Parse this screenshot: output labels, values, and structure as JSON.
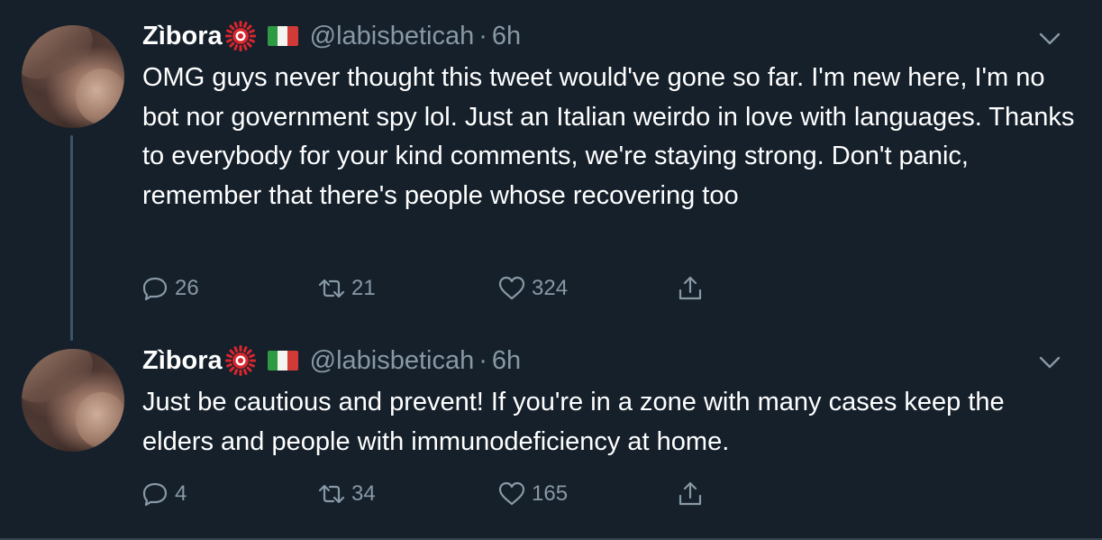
{
  "tweets": [
    {
      "display_name": "Zìbora",
      "handle": "@labisbeticah",
      "separator": "·",
      "time": "6h",
      "text": "OMG guys never thought this tweet would've gone so far. I'm new here, I'm no bot nor government spy lol. Just an Italian weirdo in love with languages. Thanks to everybody for your kind comments, we're staying strong. Don't panic, remember that there's people whose recovering too",
      "replies": "26",
      "retweets": "21",
      "likes": "324",
      "icons": {
        "reply": "speech-bubble-icon",
        "retweet": "retweet-arrows-icon",
        "like": "heart-icon",
        "share": "share-upload-icon",
        "menu": "chevron-down-icon",
        "badge": "japanese-sun-emoji",
        "flag": "italy-flag-emoji"
      }
    },
    {
      "display_name": "Zìbora",
      "handle": "@labisbeticah",
      "separator": "·",
      "time": "6h",
      "text": "Just be cautious and prevent! If you're in a zone with many cases keep the elders and people with immunodeficiency at home.",
      "replies": "4",
      "retweets": "34",
      "likes": "165",
      "icons": {
        "reply": "speech-bubble-icon",
        "retweet": "retweet-arrows-icon",
        "like": "heart-icon",
        "share": "share-upload-icon",
        "menu": "chevron-down-icon",
        "badge": "japanese-sun-emoji",
        "flag": "italy-flag-emoji"
      }
    }
  ],
  "theme": {
    "background": "#15202b",
    "text": "#ffffff",
    "secondary_text": "#8899a6",
    "thread_line": "#3d5466",
    "flag_green": "#2e9a44",
    "flag_white": "#f4f5f0",
    "flag_red": "#d23a37",
    "badge_red": "#d7262e"
  }
}
